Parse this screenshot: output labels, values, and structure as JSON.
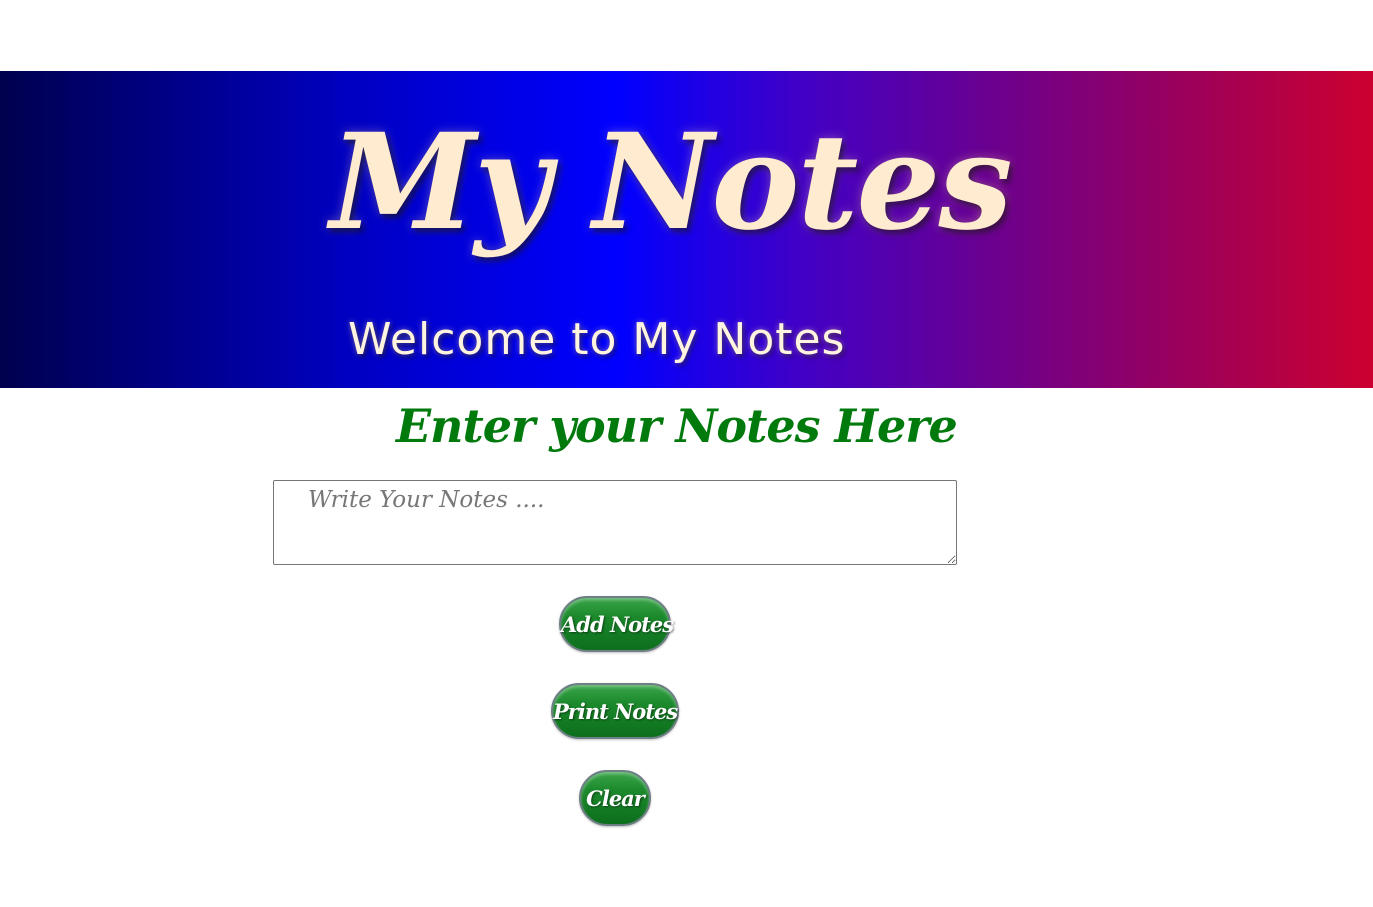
{
  "banner": {
    "title": "My Notes",
    "subtitle": "Welcome to My Notes"
  },
  "main": {
    "heading": "Enter your Notes Here",
    "notes_input": {
      "value": "",
      "placeholder": "Write Your Notes ...."
    },
    "buttons": {
      "add_label": "Add Notes",
      "print_label": "Print Notes",
      "clear_label": "Clear"
    }
  },
  "colors": {
    "heading": "#007a0c",
    "button": "#1c8a2c",
    "banner_title": "#ffebcf",
    "banner_gradient_start": "#00004e",
    "banner_gradient_mid": "#0000ff",
    "banner_gradient_end": "#cc0030"
  }
}
